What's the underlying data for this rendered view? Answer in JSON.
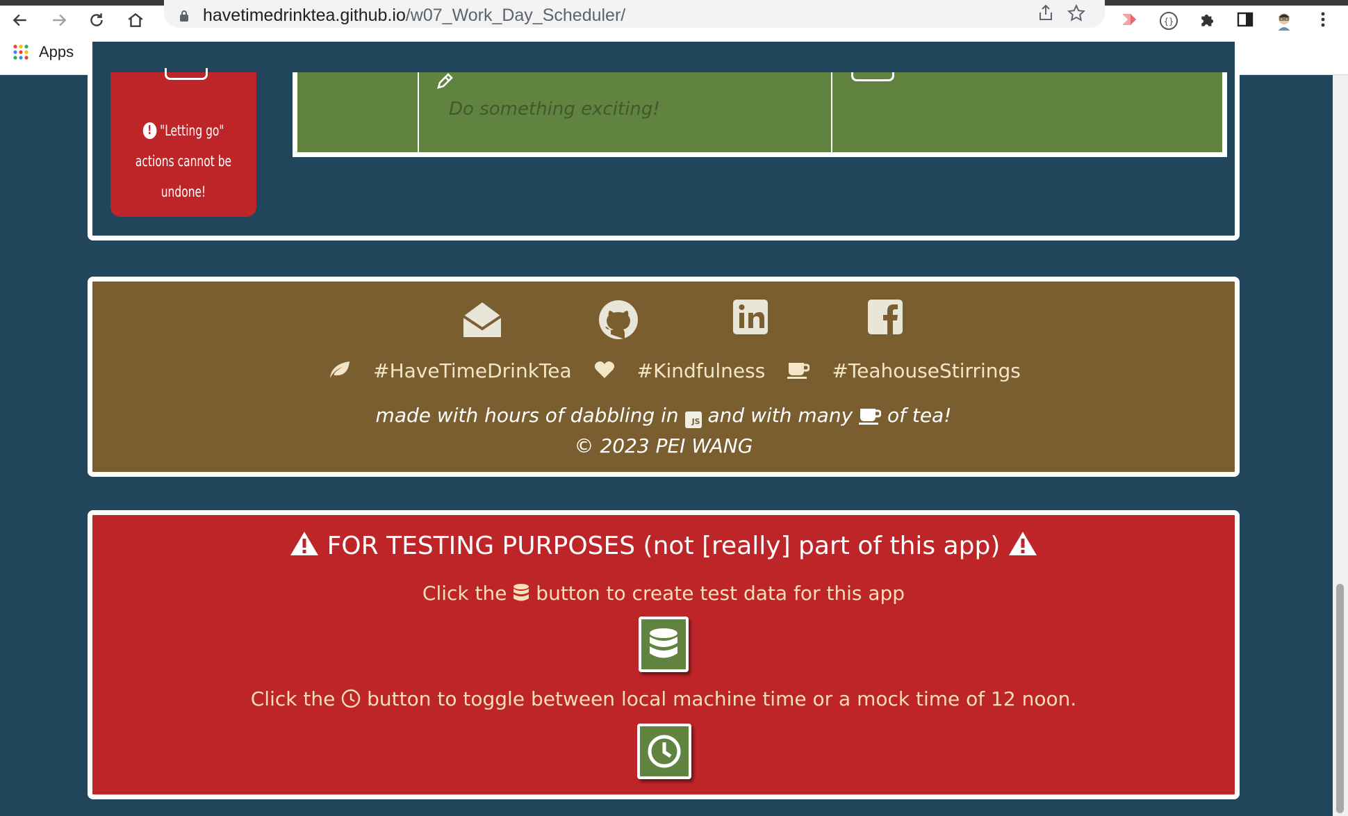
{
  "browser": {
    "url_host": "havetimedrinktea.github.io",
    "url_path": "/w07_Work_Day_Scheduler/",
    "bookmarks_apps_label": "Apps"
  },
  "scheduler": {
    "warning_text": "\"Letting go\" actions cannot be undone!",
    "row_placeholder": "Do something exciting!"
  },
  "footer": {
    "social_icons": [
      "envelope-open-icon",
      "github-icon",
      "linkedin-icon",
      "facebook-icon"
    ],
    "hashtags": [
      "#HaveTimeDrinkTea",
      "#Kindfulness",
      "#TeahouseStirrings"
    ],
    "made_with_prefix": "made with hours of dabbling in",
    "made_with_middle": "and with many",
    "made_with_suffix": "of tea!",
    "copyright": "© 2023 PEI WANG"
  },
  "testing": {
    "title": "FOR TESTING PURPOSES (not [really] part of this app)",
    "create_prefix": "Click the",
    "create_suffix": "button to create test data for this app",
    "toggle_prefix": "Click the",
    "toggle_suffix": "button to toggle between local machine time or a mock time of 12 noon."
  },
  "colors": {
    "page_bg": "#21455a",
    "accent_green": "#608440",
    "danger_red": "#be2528",
    "footer_brown": "#7b5e30",
    "footer_text": "#f3e6c7"
  }
}
